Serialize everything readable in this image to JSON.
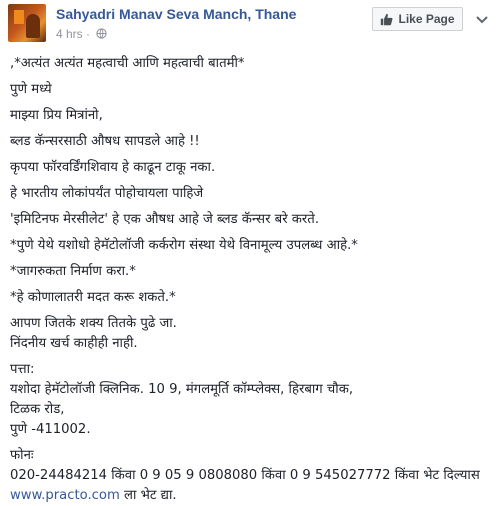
{
  "header": {
    "page_name": "Sahyadri Manav Seva Manch, Thane",
    "time": "4 hrs",
    "separator": "·",
    "privacy_icon": "globe-icon",
    "like_button": {
      "icon": "thumbs-up-icon",
      "label": "Like Page"
    },
    "menu_icon": "chevron-down-icon"
  },
  "post": {
    "paragraphs": [
      ",*अत्यंत अत्यंत महत्वाची आणि महत्वाची बातमी*",
      "पुणे मध्ये",
      "माझ्या प्रिय मित्रांनो,",
      "ब्लड कॅन्सरसाठी औषध सापडले आहे !!",
      "कृपया फॉरवर्डिंगशिवाय हे काढून टाकू नका.",
      "हे भारतीय लोकांपर्यंत पोहोचायला पाहिजे",
      "'इमिटिनफ मेरसीलेट' हे एक औषध आहे जे ब्लड कॅन्सर बरे करते.",
      "*पुणे येथे यशोधो हेमॅटोलॉजी कर्करोग संस्था येथे विनामूल्य उपलब्ध आहे.*",
      "*जागरुकता निर्माण करा.*",
      "*हे कोणालातरी मदत करू शकते.*"
    ],
    "block1": [
      "आपण जितके शक्य तितके पुढे जा.",
      "निंदनीय खर्च काहीही नाही."
    ],
    "address_label": "पत्ता:",
    "address_lines": [
      "यशोदा हेमॅटोलॉजी क्लिनिक. 10 9, मंगलमूर्ति कॉम्प्लेक्स, हिरबाग चौक,",
      "टिळक रोड,",
      "पुणे -411002."
    ],
    "phone_label": "फोनः",
    "phone_line": "020-24484214 किंवा 0 9 05 9 0808080 किंवा 0 9 545027772 किंवा भेट दिल्यास",
    "link_text": "www.practo.com",
    "link_suffix": " ला भेट द्या."
  },
  "colors": {
    "link": "#365899",
    "text": "#1d2129",
    "meta": "#90949c"
  }
}
